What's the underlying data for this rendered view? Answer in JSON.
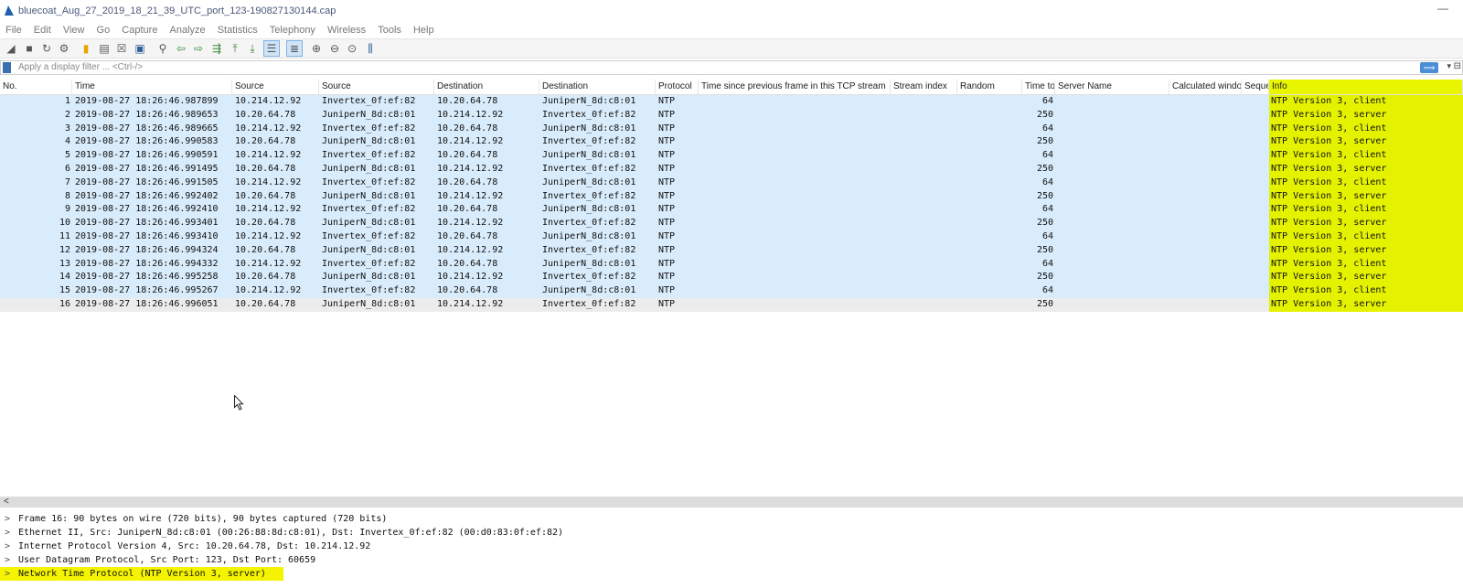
{
  "window": {
    "title": "bluecoat_Aug_27_2019_18_21_39_UTC_port_123-190827130144.cap",
    "minimize": "—"
  },
  "menu": [
    "File",
    "Edit",
    "View",
    "Go",
    "Capture",
    "Analyze",
    "Statistics",
    "Telephony",
    "Wireless",
    "Tools",
    "Help"
  ],
  "filter": {
    "placeholder": "Apply a display filter ... <Ctrl-/>"
  },
  "columns": [
    "No.",
    "Time",
    "Source",
    "Source",
    "Destination",
    "Destination",
    "Protocol",
    "Time since previous frame in this TCP stream",
    "Stream index",
    "Random",
    "Time to",
    "Server Name",
    "Calculated window",
    "Seque",
    "Info"
  ],
  "packets": [
    {
      "no": "1",
      "time": "2019-08-27 18:26:46.987899",
      "src": "10.214.12.92",
      "src_mac": "Invertex_0f:ef:82",
      "dst": "10.20.64.78",
      "dst_mac": "JuniperN_8d:c8:01",
      "proto": "NTP",
      "ttl": "64",
      "info": "NTP Version 3, client"
    },
    {
      "no": "2",
      "time": "2019-08-27 18:26:46.989653",
      "src": "10.20.64.78",
      "src_mac": "JuniperN_8d:c8:01",
      "dst": "10.214.12.92",
      "dst_mac": "Invertex_0f:ef:82",
      "proto": "NTP",
      "ttl": "250",
      "info": "NTP Version 3, server"
    },
    {
      "no": "3",
      "time": "2019-08-27 18:26:46.989665",
      "src": "10.214.12.92",
      "src_mac": "Invertex_0f:ef:82",
      "dst": "10.20.64.78",
      "dst_mac": "JuniperN_8d:c8:01",
      "proto": "NTP",
      "ttl": "64",
      "info": "NTP Version 3, client"
    },
    {
      "no": "4",
      "time": "2019-08-27 18:26:46.990583",
      "src": "10.20.64.78",
      "src_mac": "JuniperN_8d:c8:01",
      "dst": "10.214.12.92",
      "dst_mac": "Invertex_0f:ef:82",
      "proto": "NTP",
      "ttl": "250",
      "info": "NTP Version 3, server"
    },
    {
      "no": "5",
      "time": "2019-08-27 18:26:46.990591",
      "src": "10.214.12.92",
      "src_mac": "Invertex_0f:ef:82",
      "dst": "10.20.64.78",
      "dst_mac": "JuniperN_8d:c8:01",
      "proto": "NTP",
      "ttl": "64",
      "info": "NTP Version 3, client"
    },
    {
      "no": "6",
      "time": "2019-08-27 18:26:46.991495",
      "src": "10.20.64.78",
      "src_mac": "JuniperN_8d:c8:01",
      "dst": "10.214.12.92",
      "dst_mac": "Invertex_0f:ef:82",
      "proto": "NTP",
      "ttl": "250",
      "info": "NTP Version 3, server"
    },
    {
      "no": "7",
      "time": "2019-08-27 18:26:46.991505",
      "src": "10.214.12.92",
      "src_mac": "Invertex_0f:ef:82",
      "dst": "10.20.64.78",
      "dst_mac": "JuniperN_8d:c8:01",
      "proto": "NTP",
      "ttl": "64",
      "info": "NTP Version 3, client"
    },
    {
      "no": "8",
      "time": "2019-08-27 18:26:46.992402",
      "src": "10.20.64.78",
      "src_mac": "JuniperN_8d:c8:01",
      "dst": "10.214.12.92",
      "dst_mac": "Invertex_0f:ef:82",
      "proto": "NTP",
      "ttl": "250",
      "info": "NTP Version 3, server"
    },
    {
      "no": "9",
      "time": "2019-08-27 18:26:46.992410",
      "src": "10.214.12.92",
      "src_mac": "Invertex_0f:ef:82",
      "dst": "10.20.64.78",
      "dst_mac": "JuniperN_8d:c8:01",
      "proto": "NTP",
      "ttl": "64",
      "info": "NTP Version 3, client"
    },
    {
      "no": "10",
      "time": "2019-08-27 18:26:46.993401",
      "src": "10.20.64.78",
      "src_mac": "JuniperN_8d:c8:01",
      "dst": "10.214.12.92",
      "dst_mac": "Invertex_0f:ef:82",
      "proto": "NTP",
      "ttl": "250",
      "info": "NTP Version 3, server"
    },
    {
      "no": "11",
      "time": "2019-08-27 18:26:46.993410",
      "src": "10.214.12.92",
      "src_mac": "Invertex_0f:ef:82",
      "dst": "10.20.64.78",
      "dst_mac": "JuniperN_8d:c8:01",
      "proto": "NTP",
      "ttl": "64",
      "info": "NTP Version 3, client"
    },
    {
      "no": "12",
      "time": "2019-08-27 18:26:46.994324",
      "src": "10.20.64.78",
      "src_mac": "JuniperN_8d:c8:01",
      "dst": "10.214.12.92",
      "dst_mac": "Invertex_0f:ef:82",
      "proto": "NTP",
      "ttl": "250",
      "info": "NTP Version 3, server"
    },
    {
      "no": "13",
      "time": "2019-08-27 18:26:46.994332",
      "src": "10.214.12.92",
      "src_mac": "Invertex_0f:ef:82",
      "dst": "10.20.64.78",
      "dst_mac": "JuniperN_8d:c8:01",
      "proto": "NTP",
      "ttl": "64",
      "info": "NTP Version 3, client"
    },
    {
      "no": "14",
      "time": "2019-08-27 18:26:46.995258",
      "src": "10.20.64.78",
      "src_mac": "JuniperN_8d:c8:01",
      "dst": "10.214.12.92",
      "dst_mac": "Invertex_0f:ef:82",
      "proto": "NTP",
      "ttl": "250",
      "info": "NTP Version 3, server"
    },
    {
      "no": "15",
      "time": "2019-08-27 18:26:46.995267",
      "src": "10.214.12.92",
      "src_mac": "Invertex_0f:ef:82",
      "dst": "10.20.64.78",
      "dst_mac": "JuniperN_8d:c8:01",
      "proto": "NTP",
      "ttl": "64",
      "info": "NTP Version 3, client"
    },
    {
      "no": "16",
      "time": "2019-08-27 18:26:46.996051",
      "src": "10.20.64.78",
      "src_mac": "JuniperN_8d:c8:01",
      "dst": "10.214.12.92",
      "dst_mac": "Invertex_0f:ef:82",
      "proto": "NTP",
      "ttl": "250",
      "info": "NTP Version 3, server"
    }
  ],
  "details": [
    "Frame 16: 90 bytes on wire (720 bits), 90 bytes captured (720 bits)",
    "Ethernet II, Src: JuniperN_8d:c8:01 (00:26:88:8d:c8:01), Dst: Invertex_0f:ef:82 (00:d0:83:0f:ef:82)",
    "Internet Protocol Version 4, Src: 10.20.64.78, Dst: 10.214.12.92",
    "User Datagram Protocol, Src Port: 123, Dst Port: 60659",
    "Network Time Protocol (NTP Version 3, server)"
  ],
  "colors": {
    "row_bg": "#d9ecfb",
    "info_highlight": "#e4f200",
    "selected_row": "#ececec"
  }
}
